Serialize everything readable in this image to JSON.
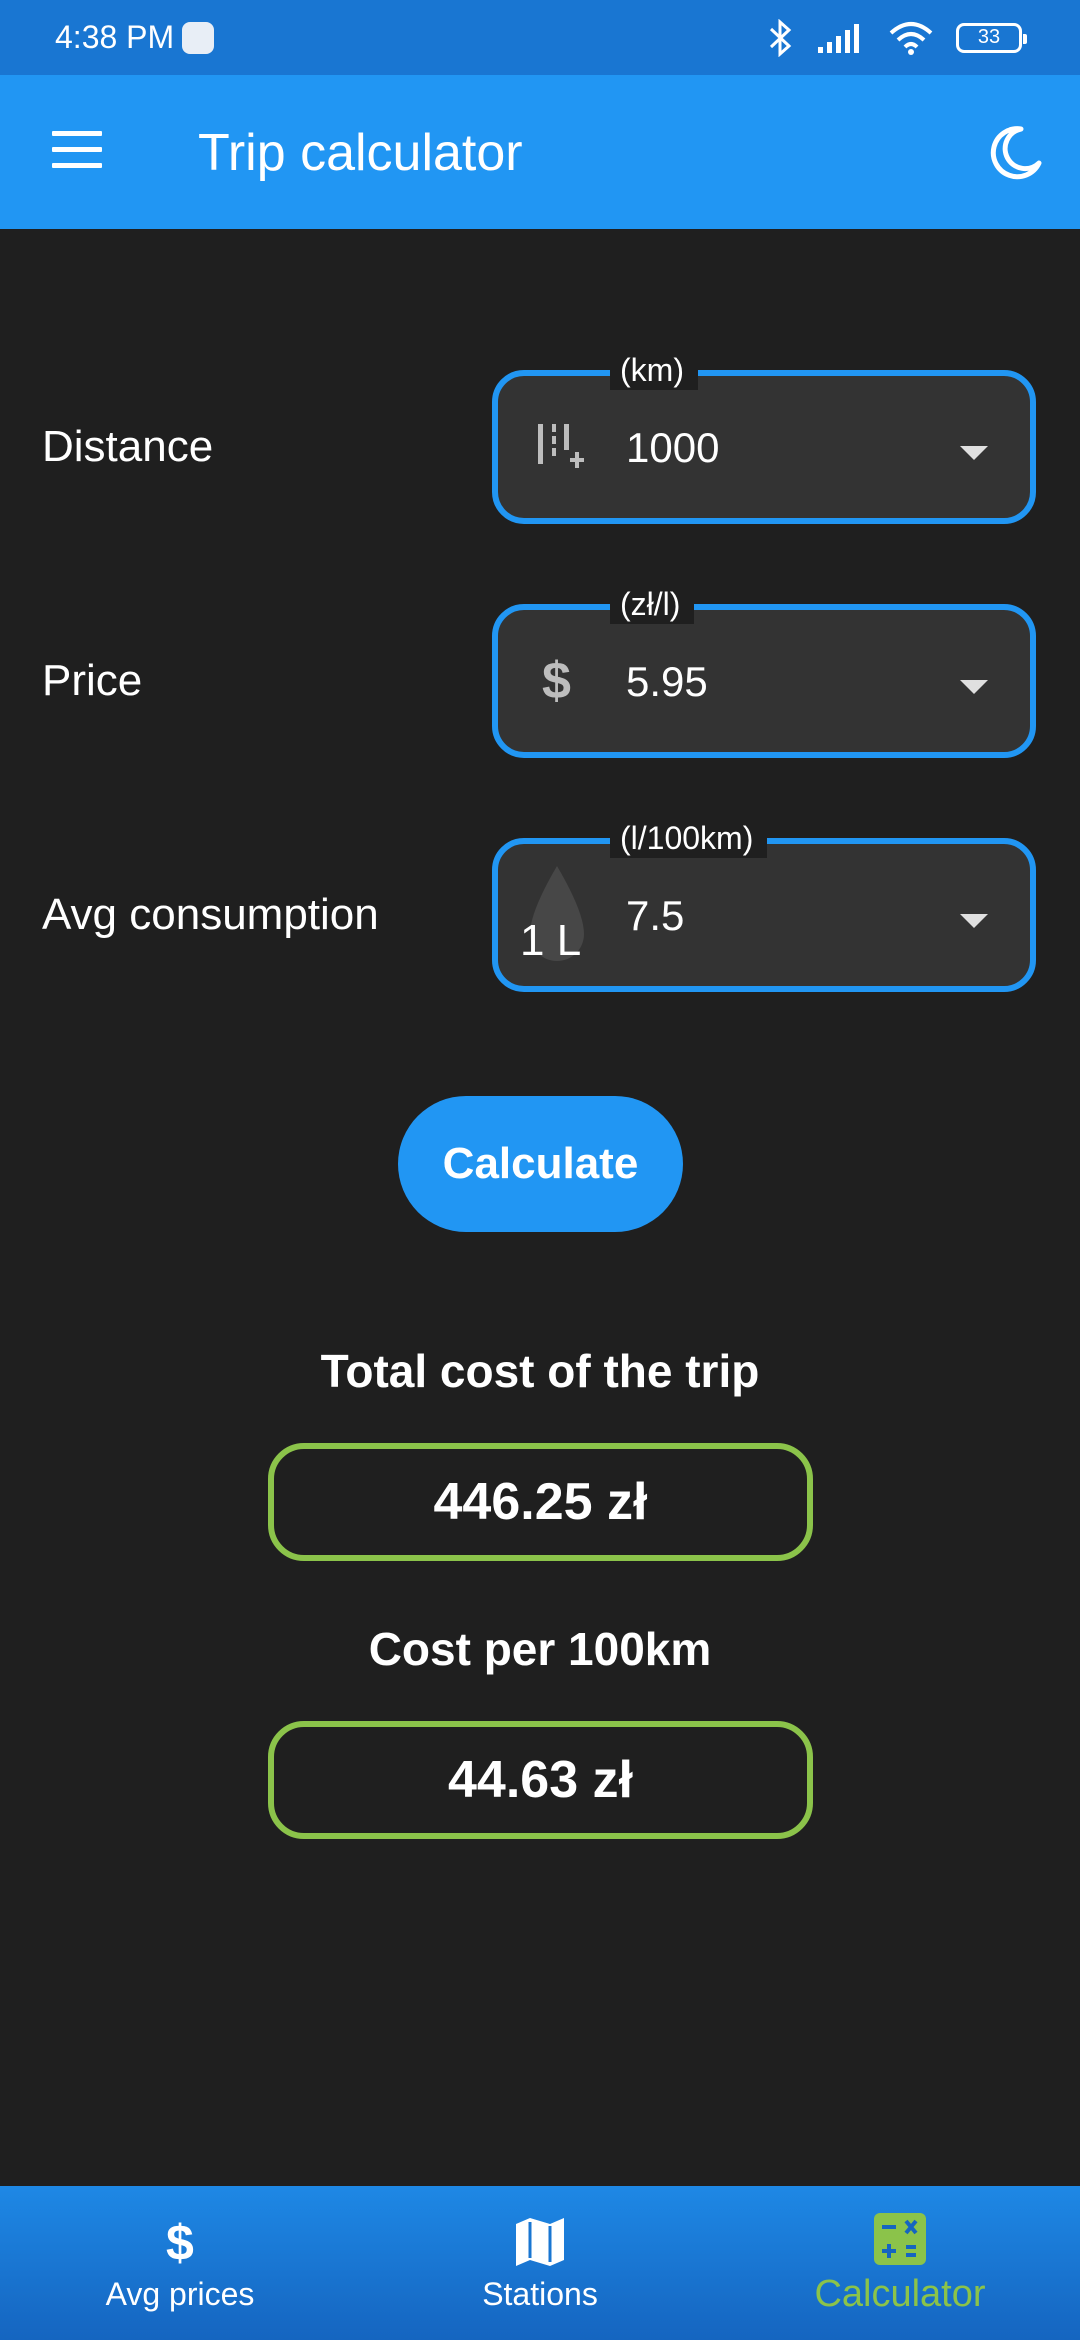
{
  "status_bar": {
    "time": "4:38 PM",
    "battery": "33"
  },
  "app_bar": {
    "title": "Trip calculator"
  },
  "form": {
    "distance": {
      "label": "Distance",
      "unit": "(km)",
      "value": "1000"
    },
    "price": {
      "label": "Price",
      "unit": "(zł/l)",
      "value": "5.95"
    },
    "consumption": {
      "label": "Avg consumption",
      "unit": "(l/100km)",
      "value": "7.5",
      "icon_text": "1 L"
    }
  },
  "calculate_button": "Calculate",
  "results": {
    "total_title": "Total cost of the trip",
    "total_value": "446.25 zł",
    "per100_title": "Cost per 100km",
    "per100_value": "44.63 zł"
  },
  "bottom_nav": {
    "items": [
      {
        "label": "Avg prices",
        "icon": "dollar-icon"
      },
      {
        "label": "Stations",
        "icon": "map-icon"
      },
      {
        "label": "Calculator",
        "icon": "calculator-icon",
        "active": true
      }
    ]
  },
  "colors": {
    "primary": "#2196f3",
    "status_bar": "#1976d2",
    "background": "#1f1f1f",
    "field_bg": "#333333",
    "accent_green": "#8bc34a"
  }
}
